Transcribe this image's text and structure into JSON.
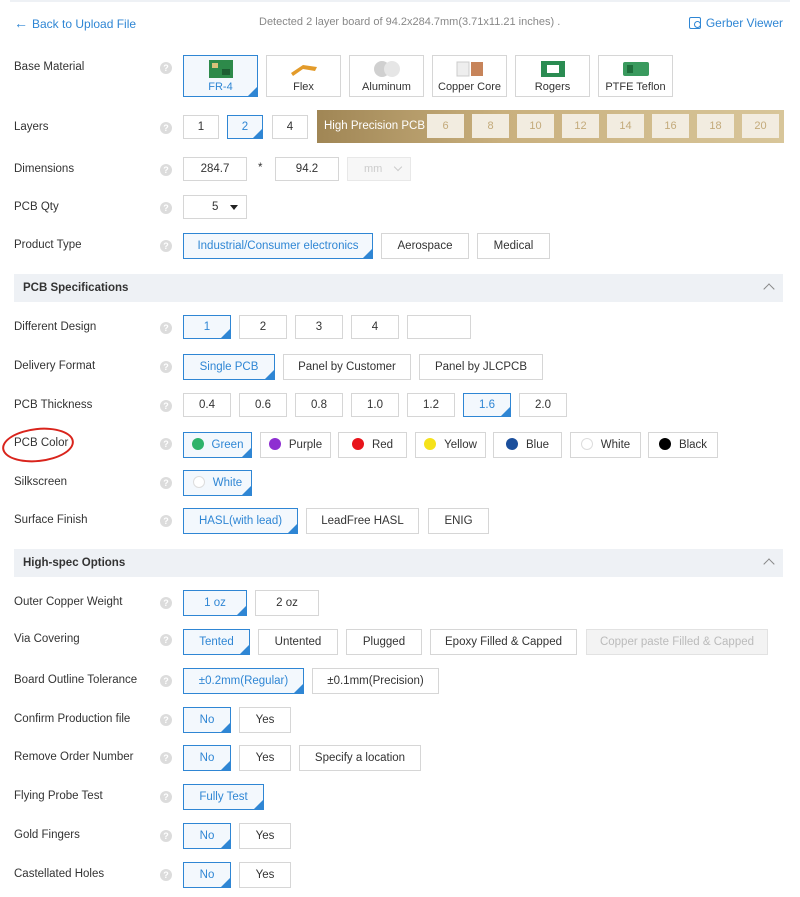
{
  "header": {
    "back": "Back to Upload File",
    "detected": "Detected 2 layer board of 94.2x284.7mm(3.71x11.21 inches) .",
    "gerber": "Gerber Viewer"
  },
  "labels": {
    "base_material": "Base Material",
    "layers": "Layers",
    "dimensions": "Dimensions",
    "pcb_qty": "PCB Qty",
    "product_type": "Product Type",
    "different_design": "Different Design",
    "delivery_format": "Delivery Format",
    "pcb_thickness": "PCB Thickness",
    "pcb_color": "PCB Color",
    "silkscreen": "Silkscreen",
    "surface_finish": "Surface Finish",
    "outer_copper": "Outer Copper Weight",
    "via_covering": "Via Covering",
    "outline_tol": "Board Outline Tolerance",
    "confirm_prod": "Confirm Production file",
    "remove_order": "Remove Order Number",
    "flying_probe": "Flying Probe Test",
    "gold_fingers": "Gold Fingers",
    "castellated": "Castellated Holes"
  },
  "help": "?",
  "materials": [
    {
      "label": "FR-4",
      "selected": true
    },
    {
      "label": "Flex"
    },
    {
      "label": "Aluminum"
    },
    {
      "label": "Copper Core"
    },
    {
      "label": "Rogers"
    },
    {
      "label": "PTFE Teflon"
    }
  ],
  "layers": [
    "1",
    "2",
    "4"
  ],
  "hp_label": "High Precision PCB",
  "hp_layers": [
    "6",
    "8",
    "10",
    "12",
    "14",
    "16",
    "18",
    "20"
  ],
  "dims": {
    "length": "284.7",
    "sep": "*",
    "width": "94.2",
    "unit": "mm"
  },
  "qty": "5",
  "product_types": [
    "Industrial/Consumer electronics",
    "Aerospace",
    "Medical"
  ],
  "sec_spec": "PCB Specifications",
  "designs": [
    "1",
    "2",
    "3",
    "4",
    ""
  ],
  "delivery": [
    "Single PCB",
    "Panel by Customer",
    "Panel by JLCPCB"
  ],
  "thickness": [
    "0.4",
    "0.6",
    "0.8",
    "1.0",
    "1.2",
    "1.6",
    "2.0"
  ],
  "colors": [
    {
      "label": "Green",
      "hex": "#2fb36a"
    },
    {
      "label": "Purple",
      "hex": "#8e2fd1"
    },
    {
      "label": "Red",
      "hex": "#e8141b"
    },
    {
      "label": "Yellow",
      "hex": "#f5e21a"
    },
    {
      "label": "Blue",
      "hex": "#1b4f9c"
    },
    {
      "label": "White",
      "hex": "#ffffff"
    },
    {
      "label": "Black",
      "hex": "#000000"
    }
  ],
  "silkscreen": "White",
  "finish": [
    "HASL(with lead)",
    "LeadFree HASL",
    "ENIG"
  ],
  "sec_high": "High-spec Options",
  "copper": [
    "1 oz",
    "2 oz"
  ],
  "via": [
    "Tented",
    "Untented",
    "Plugged",
    "Epoxy Filled & Capped",
    "Copper paste Filled & Capped"
  ],
  "tolerance": [
    "±0.2mm(Regular)",
    "±0.1mm(Precision)"
  ],
  "yesno": [
    "No",
    "Yes"
  ],
  "specify": "Specify a location",
  "fully_test": "Fully Test"
}
